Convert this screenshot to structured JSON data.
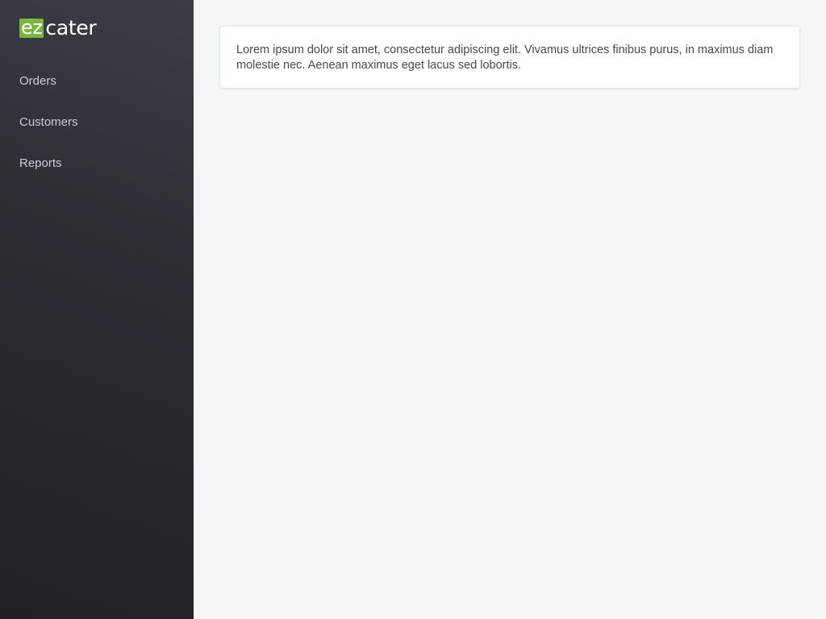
{
  "brand": {
    "logo_ez": "ez",
    "logo_cater": "cater",
    "accent_color": "#7cb342"
  },
  "sidebar": {
    "items": [
      {
        "label": "Orders"
      },
      {
        "label": "Customers"
      },
      {
        "label": "Reports"
      }
    ]
  },
  "main": {
    "card_text": "Lorem ipsum dolor sit amet, consectetur adipiscing elit. Vivamus ultrices finibus purus, in maximus diam molestie nec. Aenean maximus eget lacus sed lobortis."
  }
}
